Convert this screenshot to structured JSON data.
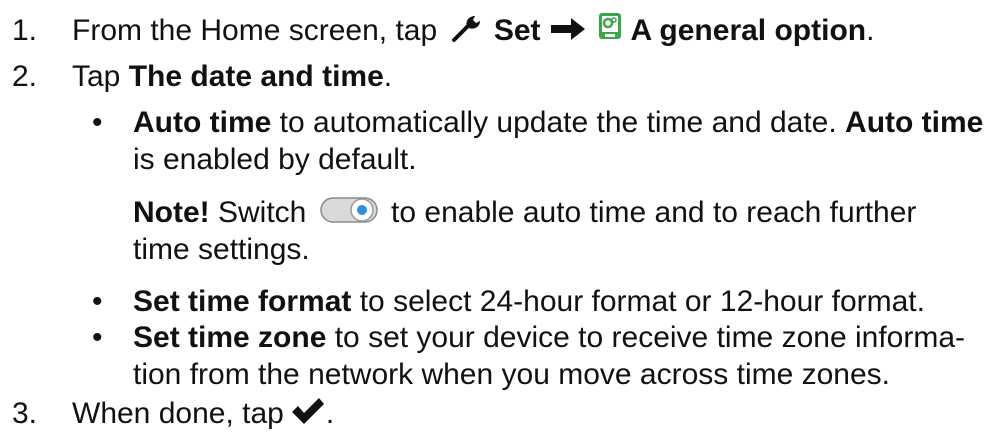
{
  "steps": [
    {
      "number": "1.",
      "pre": "From the Home screen, tap",
      "b1": "Set",
      "b2": "A general option",
      "post": "."
    },
    {
      "number": "2.",
      "pre": "Tap",
      "b1": "The date and time",
      "post": "."
    },
    {
      "number": "3.",
      "pre": "When done, tap",
      "post": "."
    }
  ],
  "bullets": [
    {
      "b1": "Auto time",
      "t1": " to automatically update the time and date.",
      "b2": "Auto time",
      "t2": "is enabled by default."
    },
    {
      "b1": "Set time format",
      "t1": " to select 24-hour format or 12-hour format."
    },
    {
      "b1": "Set time zone",
      "t1": " to set your device to receive time zone informa-",
      "t2": "tion from the network when you move across time zones."
    }
  ],
  "note": {
    "label": "Note!",
    "pre": " Switch",
    "post": "to enable auto time and to reach further",
    "post2": "time settings."
  },
  "icons": {
    "wrench": "wrench-icon",
    "arrow": "right-arrow-icon",
    "general": "phone-gear-icon",
    "toggle": "toggle-switch-icon",
    "check": "checkmark-icon"
  },
  "colors": {
    "text": "#111111",
    "general_icon": "#3aa74a",
    "toggle_knob": "#2e8fe0"
  },
  "bullet_glyph": "•"
}
